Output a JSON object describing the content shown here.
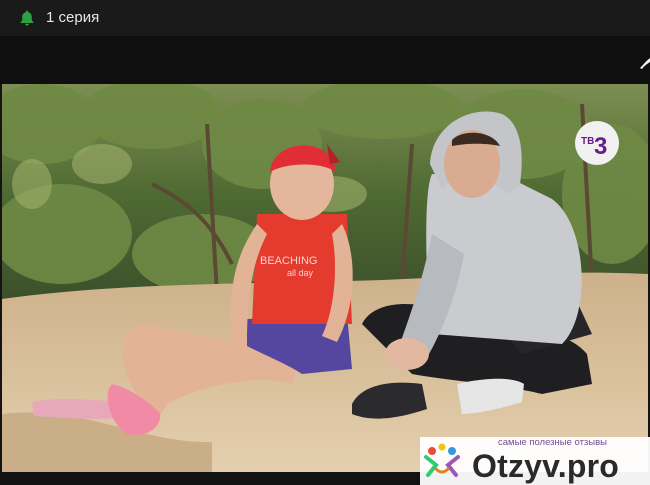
{
  "header": {
    "title": "1 серия",
    "bell_icon": "bell-icon",
    "accent_color": "#2ea043"
  },
  "video": {
    "channel_logo_text": "ТВ3",
    "channel_logo_icon": "tv3-logo"
  },
  "watermark": {
    "tagline": "самые полезные отзывы",
    "brand": "Otzyv.pro"
  }
}
